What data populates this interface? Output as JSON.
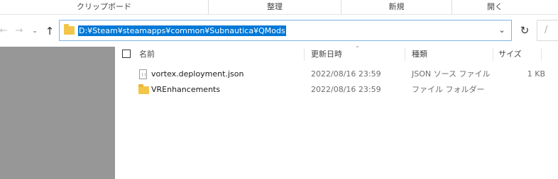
{
  "ribbon": {
    "groups": [
      "クリップボード",
      "整理",
      "新規",
      "開く"
    ]
  },
  "nav": {
    "back_icon": "arrow-left-icon",
    "forward_icon": "arrow-right-icon",
    "recent_icon": "chevron-down-icon",
    "up_icon": "arrow-up-icon",
    "address": "D:¥Steam¥steamapps¥common¥Subnautica¥QMods",
    "refresh_icon": "refresh-icon",
    "search_glyph": "/"
  },
  "columns": {
    "name": "名前",
    "date": "更新日時",
    "type": "種類",
    "size": "サイズ"
  },
  "files": [
    {
      "name": "vortex.deployment.json",
      "date": "2022/08/16 23:59",
      "type": "JSON ソース ファイル",
      "size": "1 KB",
      "icon": "json-file-icon"
    },
    {
      "name": "VREnhancements",
      "date": "2022/08/16 23:59",
      "type": "ファイル フォルダー",
      "size": "",
      "icon": "folder-icon"
    }
  ],
  "colors": {
    "selection": "#0078d7",
    "folder": "#f3c548",
    "left_pane": "#979797"
  }
}
